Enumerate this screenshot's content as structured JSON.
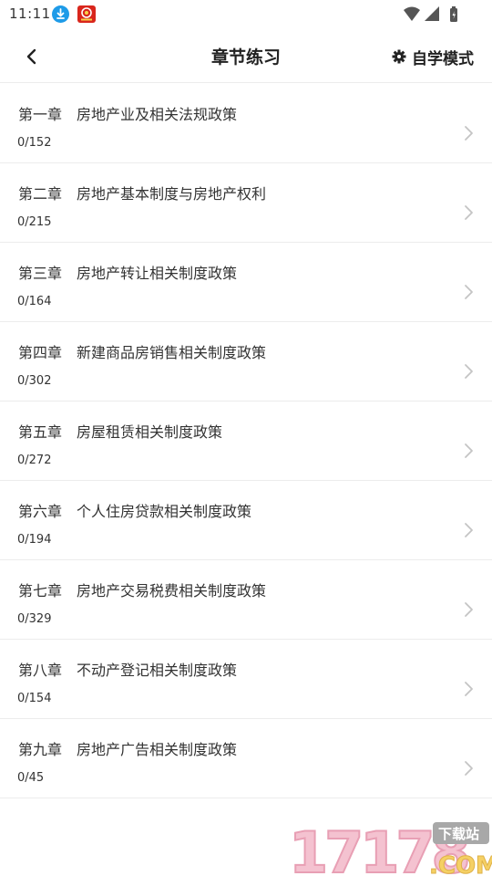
{
  "status_bar": {
    "time": "11:11",
    "icons": [
      "download-icon",
      "app-notification-icon",
      "wifi-icon",
      "signal-icon",
      "battery-icon"
    ]
  },
  "header": {
    "back_icon": "chevron-left-icon",
    "title": "章节练习",
    "mode_icon": "gear-icon",
    "mode_label": "自学模式"
  },
  "chapters": [
    {
      "number": "第一章",
      "name": "房地产业及相关法规政策",
      "progress": "0/152"
    },
    {
      "number": "第二章",
      "name": "房地产基本制度与房地产权利",
      "progress": "0/215"
    },
    {
      "number": "第三章",
      "name": "房地产转让相关制度政策",
      "progress": "0/164"
    },
    {
      "number": "第四章",
      "name": "新建商品房销售相关制度政策",
      "progress": "0/302"
    },
    {
      "number": "第五章",
      "name": "房屋租赁相关制度政策",
      "progress": "0/272"
    },
    {
      "number": "第六章",
      "name": "个人住房贷款相关制度政策",
      "progress": "0/194"
    },
    {
      "number": "第七章",
      "name": "房地产交易税费相关制度政策",
      "progress": "0/329"
    },
    {
      "number": "第八章",
      "name": "不动产登记相关制度政策",
      "progress": "0/154"
    },
    {
      "number": "第九章",
      "name": "房地产广告相关制度政策",
      "progress": "0/45"
    }
  ],
  "watermark": {
    "text": "17178",
    "suffix": ".COM",
    "badge": "下载站"
  },
  "colors": {
    "accent_blue": "#1e9be8",
    "app_red": "#d9261c",
    "divider": "#ececec",
    "chevron": "#c4c4c4"
  }
}
